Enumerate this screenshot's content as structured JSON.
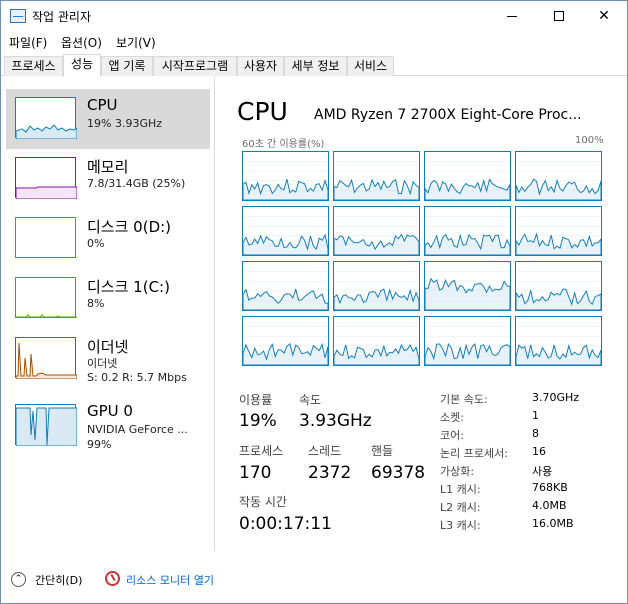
{
  "window": {
    "title": "작업 관리자"
  },
  "menu": [
    "파일(F)",
    "옵션(O)",
    "보기(V)"
  ],
  "tabs": [
    "프로세스",
    "성능",
    "앱 기록",
    "시작프로그램",
    "사용자",
    "세부 정보",
    "서비스"
  ],
  "active_tab": "성능",
  "sidebar": [
    {
      "title": "CPU",
      "lines": [
        "19% 3.93GHz"
      ],
      "color": "#117dbb",
      "selected": true
    },
    {
      "title": "메모리",
      "lines": [
        "7.8/31.4GB (25%)"
      ],
      "color": "#8b12ae",
      "selected": false
    },
    {
      "title": "디스크 0(D:)",
      "lines": [
        "0%"
      ],
      "color": "#4da60c",
      "selected": false
    },
    {
      "title": "디스크 1(C:)",
      "lines": [
        "8%"
      ],
      "color": "#4da60c",
      "selected": false
    },
    {
      "title": "이더넷",
      "lines": [
        "이더넷",
        "S: 0.2  R: 5.7 Mbps"
      ],
      "color": "#a74f01",
      "selected": false
    },
    {
      "title": "GPU 0",
      "lines": [
        "NVIDIA GeForce ...",
        "99%"
      ],
      "color": "#117dbb",
      "selected": false
    }
  ],
  "main": {
    "title": "CPU",
    "model": "AMD Ryzen 7 2700X Eight-Core Proc...",
    "graph_label_left": "60초 간 이용률(%)",
    "graph_label_right": "100%",
    "usage_label": "이용률",
    "usage_value": "19%",
    "speed_label": "속도",
    "speed_value": "3.93GHz",
    "process_label": "프로세스",
    "process_value": "170",
    "thread_label": "스레드",
    "thread_value": "2372",
    "handle_label": "핸들",
    "handle_value": "69378",
    "uptime_label": "작동 시간",
    "uptime_value": "0:00:17:11",
    "specs": [
      {
        "label": "기본 속도:",
        "value": "3.70GHz"
      },
      {
        "label": "소켓:",
        "value": "1"
      },
      {
        "label": "코어:",
        "value": "8"
      },
      {
        "label": "논리 프로세서:",
        "value": "16"
      },
      {
        "label": "가상화:",
        "value": "사용"
      },
      {
        "label": "L1 캐시:",
        "value": "768KB"
      },
      {
        "label": "L2 캐시:",
        "value": "4.0MB"
      },
      {
        "label": "L3 캐시:",
        "value": "16.0MB"
      }
    ]
  },
  "footer": {
    "fewer_details": "간단히(D)",
    "resource_monitor": "리소스 모니터 열기"
  },
  "colors": {
    "cpu": "#117dbb",
    "grid": "#d9eaf4",
    "selected_bg": "#d9d9d9"
  }
}
